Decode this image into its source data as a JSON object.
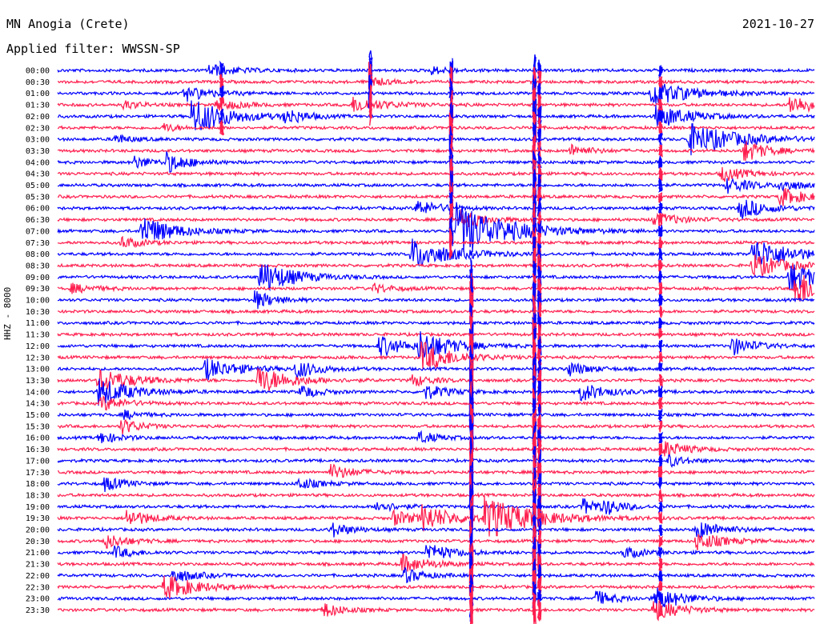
{
  "header": {
    "station": "MN Anogia (Crete)",
    "filter_prefix": "Applied filter:",
    "filter_name": "WWSSN-SP",
    "date": "2021-10-27"
  },
  "channel_label": "HHZ - 8000",
  "colors": {
    "even_rows": "#0000ff",
    "odd_rows": "#ff1f4f",
    "background": "#ffffff",
    "text": "#000000"
  },
  "chart_data": {
    "type": "line",
    "title": "MN Anogia (Crete)",
    "subtitle": "Applied filter: WWSSN-SP",
    "date": "2021-10-27",
    "ylabel": "HHZ - 8000",
    "xlabel": "",
    "x_range_minutes": [
      0,
      30
    ],
    "row_labels": [
      "00:00",
      "00:30",
      "01:00",
      "01:30",
      "02:00",
      "02:30",
      "03:00",
      "03:30",
      "04:00",
      "04:30",
      "05:00",
      "05:30",
      "06:00",
      "06:30",
      "07:00",
      "07:30",
      "08:00",
      "08:30",
      "09:00",
      "09:30",
      "10:00",
      "10:30",
      "11:00",
      "11:30",
      "12:00",
      "12:30",
      "13:00",
      "13:30",
      "14:00",
      "14:30",
      "15:00",
      "15:30",
      "16:00",
      "16:30",
      "17:00",
      "17:30",
      "18:00",
      "18:30",
      "19:00",
      "19:30",
      "20:00",
      "20:30",
      "21:00",
      "21:30",
      "22:00",
      "22:30",
      "23:00",
      "23:30"
    ],
    "series": [
      {
        "values": []
      }
    ],
    "events": [
      {
        "row": 0,
        "t": 6.0,
        "amp": 8,
        "dur": 1.6
      },
      {
        "row": 0,
        "t": 14.8,
        "amp": 5,
        "dur": 1.2
      },
      {
        "row": 1,
        "t": 12.5,
        "amp": 5,
        "dur": 1.0
      },
      {
        "row": 2,
        "t": 5.0,
        "amp": 10,
        "dur": 1.6
      },
      {
        "row": 2,
        "t": 23.5,
        "amp": 16,
        "dur": 2.4
      },
      {
        "row": 3,
        "t": 2.6,
        "amp": 6,
        "dur": 1.0
      },
      {
        "row": 3,
        "t": 6.3,
        "amp": 8,
        "dur": 1.3
      },
      {
        "row": 3,
        "t": 11.7,
        "amp": 10,
        "dur": 2.0
      },
      {
        "row": 3,
        "t": 29.0,
        "amp": 12,
        "dur": 2.0
      },
      {
        "row": 4,
        "t": 5.3,
        "amp": 24,
        "dur": 2.2
      },
      {
        "row": 4,
        "t": 9.0,
        "amp": 10,
        "dur": 1.2
      },
      {
        "row": 4,
        "t": 23.7,
        "amp": 16,
        "dur": 2.0
      },
      {
        "row": 5,
        "t": 4.2,
        "amp": 6,
        "dur": 0.8
      },
      {
        "row": 6,
        "t": 2.2,
        "amp": 7,
        "dur": 1.0
      },
      {
        "row": 6,
        "t": 25.0,
        "amp": 20,
        "dur": 3.0
      },
      {
        "row": 7,
        "t": 20.3,
        "amp": 8,
        "dur": 1.2
      },
      {
        "row": 7,
        "t": 27.2,
        "amp": 14,
        "dur": 1.4
      },
      {
        "row": 8,
        "t": 3.0,
        "amp": 8,
        "dur": 1.2
      },
      {
        "row": 8,
        "t": 4.3,
        "amp": 12,
        "dur": 1.4
      },
      {
        "row": 9,
        "t": 26.3,
        "amp": 10,
        "dur": 1.4
      },
      {
        "row": 10,
        "t": 26.5,
        "amp": 10,
        "dur": 1.5
      },
      {
        "row": 10,
        "t": 28.6,
        "amp": 8,
        "dur": 1.2
      },
      {
        "row": 11,
        "t": 28.6,
        "amp": 12,
        "dur": 1.6
      },
      {
        "row": 12,
        "t": 14.2,
        "amp": 10,
        "dur": 1.5
      },
      {
        "row": 12,
        "t": 27.0,
        "amp": 14,
        "dur": 1.6
      },
      {
        "row": 13,
        "t": 16.0,
        "amp": 12,
        "dur": 1.4
      },
      {
        "row": 13,
        "t": 23.6,
        "amp": 10,
        "dur": 1.5
      },
      {
        "row": 14,
        "t": 3.3,
        "amp": 20,
        "dur": 2.0
      },
      {
        "row": 14,
        "t": 15.8,
        "amp": 36,
        "dur": 3.0
      },
      {
        "row": 15,
        "t": 2.5,
        "amp": 8,
        "dur": 1.2
      },
      {
        "row": 16,
        "t": 14.0,
        "amp": 20,
        "dur": 2.4
      },
      {
        "row": 16,
        "t": 27.5,
        "amp": 20,
        "dur": 2.5
      },
      {
        "row": 17,
        "t": 27.5,
        "amp": 16,
        "dur": 2.0
      },
      {
        "row": 18,
        "t": 8.0,
        "amp": 22,
        "dur": 2.0
      },
      {
        "row": 18,
        "t": 29.0,
        "amp": 20,
        "dur": 1.8
      },
      {
        "row": 19,
        "t": 29.2,
        "amp": 26,
        "dur": 1.6
      },
      {
        "row": 19,
        "t": 0.5,
        "amp": 6,
        "dur": 1.4
      },
      {
        "row": 19,
        "t": 12.5,
        "amp": 6,
        "dur": 1.2
      },
      {
        "row": 20,
        "t": 7.8,
        "amp": 12,
        "dur": 1.2
      },
      {
        "row": 24,
        "t": 12.7,
        "amp": 14,
        "dur": 1.6
      },
      {
        "row": 24,
        "t": 14.3,
        "amp": 18,
        "dur": 2.0
      },
      {
        "row": 24,
        "t": 26.7,
        "amp": 12,
        "dur": 1.4
      },
      {
        "row": 25,
        "t": 14.4,
        "amp": 20,
        "dur": 2.0
      },
      {
        "row": 26,
        "t": 5.8,
        "amp": 14,
        "dur": 2.0
      },
      {
        "row": 26,
        "t": 9.4,
        "amp": 12,
        "dur": 1.4
      },
      {
        "row": 26,
        "t": 20.2,
        "amp": 10,
        "dur": 1.2
      },
      {
        "row": 27,
        "t": 1.6,
        "amp": 16,
        "dur": 2.0
      },
      {
        "row": 27,
        "t": 7.9,
        "amp": 18,
        "dur": 2.0
      },
      {
        "row": 27,
        "t": 14.0,
        "amp": 8,
        "dur": 1.2
      },
      {
        "row": 28,
        "t": 1.6,
        "amp": 18,
        "dur": 2.0
      },
      {
        "row": 28,
        "t": 9.6,
        "amp": 10,
        "dur": 1.0
      },
      {
        "row": 28,
        "t": 14.5,
        "amp": 10,
        "dur": 1.4
      },
      {
        "row": 28,
        "t": 20.7,
        "amp": 12,
        "dur": 1.6
      },
      {
        "row": 29,
        "t": 1.7,
        "amp": 10,
        "dur": 1.4
      },
      {
        "row": 30,
        "t": 2.6,
        "amp": 6,
        "dur": 1.0
      },
      {
        "row": 31,
        "t": 2.5,
        "amp": 10,
        "dur": 1.2
      },
      {
        "row": 32,
        "t": 1.6,
        "amp": 8,
        "dur": 1.2
      },
      {
        "row": 32,
        "t": 14.3,
        "amp": 8,
        "dur": 1.2
      },
      {
        "row": 33,
        "t": 23.9,
        "amp": 12,
        "dur": 1.4
      },
      {
        "row": 34,
        "t": 24.2,
        "amp": 8,
        "dur": 1.0
      },
      {
        "row": 35,
        "t": 10.8,
        "amp": 10,
        "dur": 1.4
      },
      {
        "row": 36,
        "t": 1.8,
        "amp": 10,
        "dur": 1.2
      },
      {
        "row": 36,
        "t": 9.5,
        "amp": 8,
        "dur": 1.2
      },
      {
        "row": 38,
        "t": 12.6,
        "amp": 8,
        "dur": 1.2
      },
      {
        "row": 38,
        "t": 20.8,
        "amp": 10,
        "dur": 1.4
      },
      {
        "row": 38,
        "t": 21.7,
        "amp": 8,
        "dur": 1.0
      },
      {
        "row": 39,
        "t": 2.7,
        "amp": 12,
        "dur": 1.4
      },
      {
        "row": 39,
        "t": 13.3,
        "amp": 10,
        "dur": 1.4
      },
      {
        "row": 39,
        "t": 14.4,
        "amp": 16,
        "dur": 2.0
      },
      {
        "row": 39,
        "t": 16.9,
        "amp": 26,
        "dur": 3.0
      },
      {
        "row": 40,
        "t": 10.8,
        "amp": 10,
        "dur": 1.2
      },
      {
        "row": 40,
        "t": 25.3,
        "amp": 12,
        "dur": 1.6
      },
      {
        "row": 41,
        "t": 1.8,
        "amp": 10,
        "dur": 1.4
      },
      {
        "row": 41,
        "t": 25.3,
        "amp": 12,
        "dur": 1.6
      },
      {
        "row": 42,
        "t": 2.2,
        "amp": 8,
        "dur": 1.2
      },
      {
        "row": 42,
        "t": 14.6,
        "amp": 12,
        "dur": 1.6
      },
      {
        "row": 42,
        "t": 22.4,
        "amp": 8,
        "dur": 1.2
      },
      {
        "row": 43,
        "t": 13.6,
        "amp": 12,
        "dur": 1.6
      },
      {
        "row": 44,
        "t": 4.5,
        "amp": 10,
        "dur": 1.4
      },
      {
        "row": 44,
        "t": 13.7,
        "amp": 10,
        "dur": 1.2
      },
      {
        "row": 45,
        "t": 4.2,
        "amp": 16,
        "dur": 2.0
      },
      {
        "row": 46,
        "t": 21.3,
        "amp": 10,
        "dur": 1.2
      },
      {
        "row": 46,
        "t": 23.7,
        "amp": 16,
        "dur": 1.6
      },
      {
        "row": 47,
        "t": 10.5,
        "amp": 10,
        "dur": 1.2
      },
      {
        "row": 47,
        "t": 23.6,
        "amp": 14,
        "dur": 1.6
      }
    ],
    "spikes": [
      {
        "t": 12.4,
        "row_from": 0,
        "row_to": 4,
        "amp": 26
      },
      {
        "t": 15.6,
        "row_from": 0,
        "row_to": 16,
        "amp": 20
      },
      {
        "t": 16.4,
        "row_from": 18,
        "row_to": 48,
        "amp": 30
      },
      {
        "t": 18.9,
        "row_from": 0,
        "row_to": 48,
        "amp": 22
      },
      {
        "t": 19.1,
        "row_from": 0,
        "row_to": 48,
        "amp": 14
      },
      {
        "t": 23.9,
        "row_from": 0,
        "row_to": 48,
        "amp": 8
      },
      {
        "t": 6.5,
        "row_from": 0,
        "row_to": 6,
        "amp": 10
      }
    ],
    "grid": false
  }
}
